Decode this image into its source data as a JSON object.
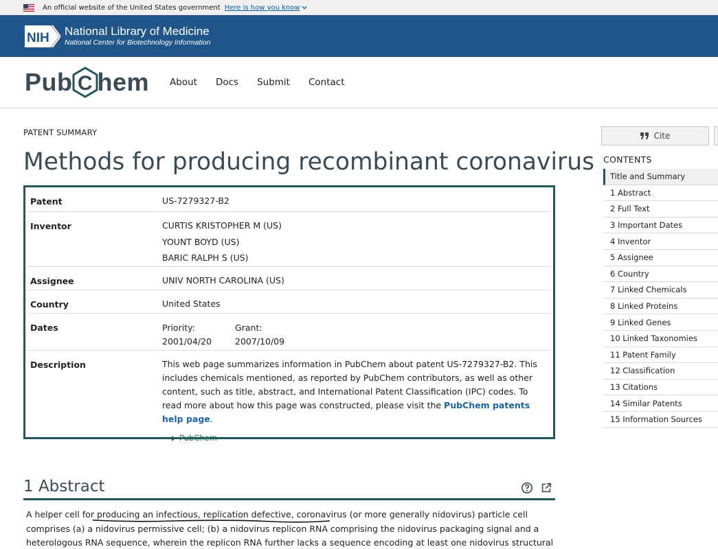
{
  "gov_banner": {
    "text": "An official website of the United States government",
    "link": "Here is how you know"
  },
  "nih": {
    "logo_text": "NIH",
    "title": "National Library of Medicine",
    "subtitle": "National Center for Biotechnology Information"
  },
  "pubchem": {
    "logo_left": "Pub",
    "logo_mid": "C",
    "logo_right": "hem",
    "nav": [
      "About",
      "Docs",
      "Submit",
      "Contact"
    ]
  },
  "page": {
    "eyebrow": "PATENT SUMMARY",
    "title": "Methods for producing recombinant coronavirus"
  },
  "summary": {
    "patent_label": "Patent",
    "patent_value": "US-7279327-B2",
    "inventor_label": "Inventor",
    "inventors": [
      "CURTIS KRISTOPHER M (US)",
      "YOUNT BOYD (US)",
      "BARIC RALPH S (US)"
    ],
    "assignee_label": "Assignee",
    "assignee_value": "UNIV NORTH CAROLINA (US)",
    "country_label": "Country",
    "country_value": "United States",
    "dates_label": "Dates",
    "priority_label": "Priority:",
    "priority_value": "2001/04/20",
    "grant_label": "Grant:",
    "grant_value": "2007/10/09",
    "description_label": "Description",
    "description_text": "This web page summarizes information in PubChem about patent US-7279327-B2. This includes chemicals mentioned, as reported by PubChem contributors, as well as other content, such as title, abstract, and International Patent Classification (IPC) codes. To read more about how this page was constructed, please visit the ",
    "description_link": "PubChem patents help page",
    "description_end": ".",
    "toggle_label": "PubChem"
  },
  "abstract": {
    "title": "1 Abstract",
    "text": "A helper cell for producing an infectious, replication defective, coronavirus (or more generally nidovirus) particle cell comprises (a) a nidovirus permissive cell; (b) a nidovirus replicon RNA comprising the nidovirus packaging signal and a heterologous RNA sequence, wherein the replicon RNA further lacks a sequence encoding at least one nidovirus structural protein; and (c) at least"
  },
  "sidebar": {
    "cite_label": "Cite",
    "contents_heading": "CONTENTS",
    "items": [
      "Title and Summary",
      "1 Abstract",
      "2 Full Text",
      "3 Important Dates",
      "4 Inventor",
      "5 Assignee",
      "6 Country",
      "7 Linked Chemicals",
      "8 Linked Proteins",
      "9 Linked Genes",
      "10 Linked Taxonomies",
      "11 Patent Family",
      "12 Classification",
      "13 Citations",
      "14 Similar Patents",
      "15 Information Sources"
    ]
  },
  "colors": {
    "nih_blue": "#20558a",
    "pubchem_teal": "#22575b",
    "link_blue": "#1a63a6"
  }
}
